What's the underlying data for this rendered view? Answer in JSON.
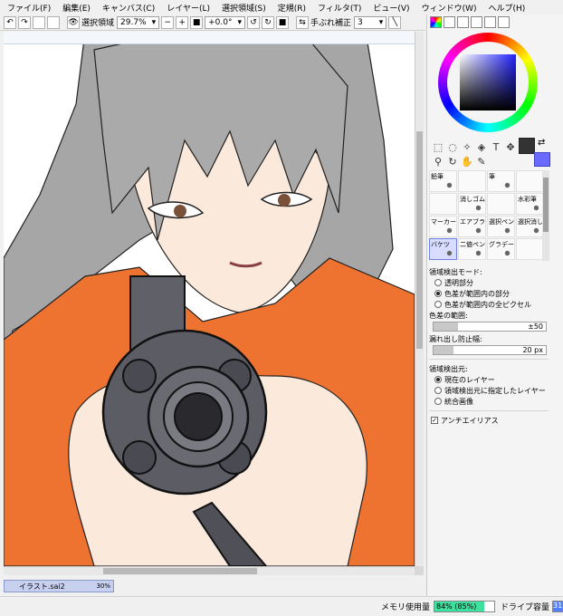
{
  "menu": [
    "ファイル(F)",
    "編集(E)",
    "キャンバス(C)",
    "レイヤー(L)",
    "選択領域(S)",
    "定規(R)",
    "フィルタ(T)",
    "ビュー(V)",
    "ウィンドウ(W)",
    "ヘルプ(H)"
  ],
  "toolbar": {
    "selection_label": "選択領域",
    "zoom_value": "29.7%",
    "rotate_value": "+0.0°",
    "stabilizer_label": "手ぶれ補正",
    "stabilizer_value": "3"
  },
  "document": {
    "name": "イラスト.sai2",
    "zoom": "30%"
  },
  "status": {
    "memory_label": "メモリ使用量",
    "memory_value": "84% (85%)",
    "memory_fraction": 0.84,
    "drive_label": "ドライブ容量",
    "drive_value": "31"
  },
  "colors": {
    "foreground": "#333333",
    "background": "#6a6aff",
    "accent": "#5080ff"
  },
  "brushes": [
    {
      "label": "鉛筆",
      "selected": false
    },
    {
      "label": "",
      "selected": false
    },
    {
      "label": "筆",
      "selected": false
    },
    {
      "label": "",
      "selected": false
    },
    {
      "label": "",
      "selected": false
    },
    {
      "label": "消しゴム",
      "selected": false
    },
    {
      "label": "",
      "selected": false
    },
    {
      "label": "水彩筆",
      "selected": false
    },
    {
      "label": "マーカー",
      "selected": false
    },
    {
      "label": "エアブラシ",
      "selected": false
    },
    {
      "label": "選択ペン",
      "selected": false
    },
    {
      "label": "選択消し",
      "selected": false
    },
    {
      "label": "バケツ",
      "selected": true
    },
    {
      "label": "二値ペン",
      "selected": false
    },
    {
      "label": "グラデーション",
      "selected": false
    },
    {
      "label": "",
      "selected": false
    }
  ],
  "fill_props": {
    "mode_label": "領域検出モード:",
    "modes": [
      "透明部分",
      "色差が範囲内の部分",
      "色差が範囲内の全ピクセル"
    ],
    "mode_selected": 1,
    "color_range_label": "色差の範囲:",
    "color_range_value": "±50",
    "leak_label": "漏れ出し防止幅:",
    "leak_value": "20 px",
    "source_label": "領域検出元:",
    "sources": [
      "現在のレイヤー",
      "領域検出元に指定したレイヤー",
      "統合画像"
    ],
    "source_selected": 0,
    "antialias_label": "アンチエイリアス"
  }
}
